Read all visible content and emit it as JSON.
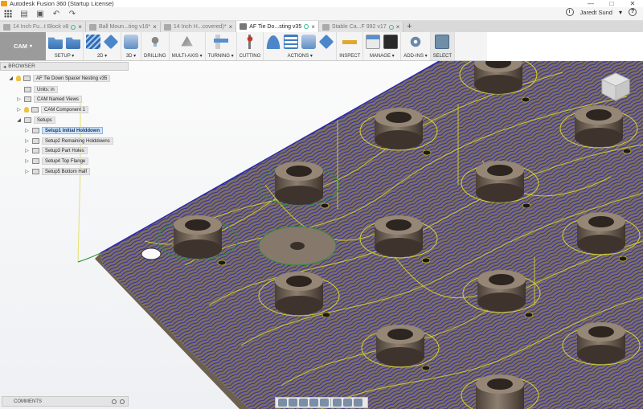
{
  "window": {
    "title": "Autodesk Fusion 360 (Startup License)",
    "controls": [
      "—",
      "□",
      "✕"
    ]
  },
  "quick_access": {
    "user_name": "Jaredt Sund",
    "user_caret": "▾",
    "icons": [
      "grid-icon",
      "file-icon",
      "save-icon",
      "undo-icon",
      "redo-icon",
      "clock-icon",
      "help-icon"
    ]
  },
  "tabs": [
    {
      "label": "14 Inch Fu...t Block v8",
      "active": false
    },
    {
      "label": "Ball Moun...ting v16*",
      "active": false
    },
    {
      "label": "14 Inch H...covered)*",
      "active": false
    },
    {
      "label": "AF Tie Do...sting v35",
      "active": true
    },
    {
      "label": "Stable Ca...F 992 v17",
      "active": false
    }
  ],
  "ribbon": {
    "workspace": "CAM",
    "groups": {
      "setup": "SETUP ▾",
      "two_d": "2D ▾",
      "three_d": "3D ▾",
      "drilling": "DRILLING",
      "multi_axis": "MULTI-AXIS ▾",
      "turning": "TURNING ▾",
      "cutting": "CUTTING",
      "actions": "ACTIONS ▾",
      "inspect": "INSPECT",
      "manage": "MANAGE ▾",
      "add_ins": "ADD-INS ▾",
      "select": "SELECT"
    }
  },
  "browser": {
    "title": "BROWSER",
    "items": [
      {
        "label": "AF Tie Down Spacer Nesting v35"
      },
      {
        "label": "Units: in"
      },
      {
        "label": "CAM Named Views"
      },
      {
        "label": "CAM Component 1"
      },
      {
        "label": "Setups"
      },
      {
        "label": "Setup1 Initial Holddown"
      },
      {
        "label": "Setup2 Remaining Holddowns"
      },
      {
        "label": "Setup3 Part Holes"
      },
      {
        "label": "Setup4 Top Flange"
      },
      {
        "label": "Setup5 Bottom Half"
      }
    ]
  },
  "comments": {
    "label": "COMMENTS"
  },
  "watermark": "www.bimarc.ru",
  "colors": {
    "toolpath_yellow": "#d4cf2a",
    "toolpath_blue": "#2323a8",
    "stock_brown": "#7a6a58",
    "selection_blue": "#cfe3fb"
  }
}
